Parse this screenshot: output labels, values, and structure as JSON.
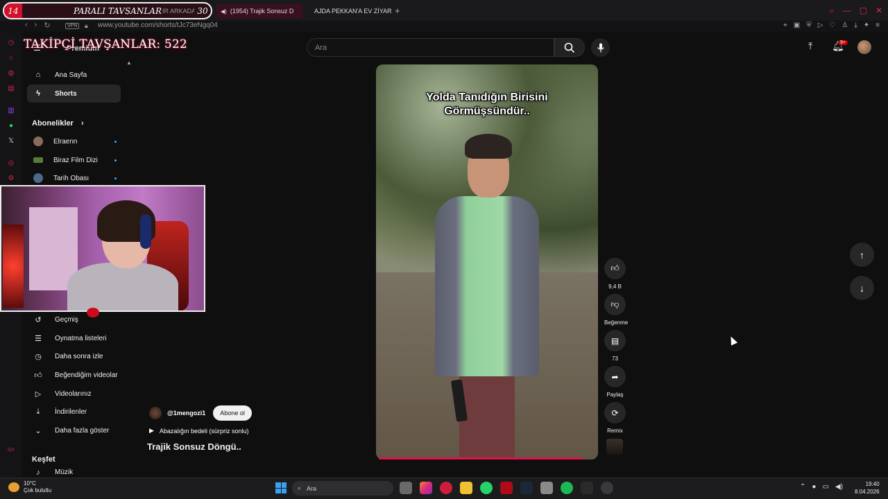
{
  "stream": {
    "left_number": "14",
    "brand": "PARALI TAVŞANLAR",
    "ticker": "IR ARKADAŞ İÇİN; SA",
    "right_number": "30",
    "follow_counter": "TAKİPÇİ TAVŞANLAR: 522"
  },
  "browser": {
    "tabs": [
      {
        "label": "(1954) Trajik Sonsuz D",
        "active": true
      },
      {
        "label": "AJDA PEKKAN'A EV ZİYAR",
        "active": false
      }
    ],
    "url": "www.youtube.com/shorts/tJc73eNgq04",
    "vpn": "VPN"
  },
  "header": {
    "premium": "Premium",
    "search_placeholder": "Ara",
    "notification_count": "9+"
  },
  "sidebar": {
    "main": [
      {
        "label": "Ana Sayfa",
        "icon": "home-icon"
      },
      {
        "label": "Shorts",
        "icon": "shorts-icon"
      }
    ],
    "subscriptions_heading": "Abonelikler",
    "subscriptions": [
      {
        "label": "Elraenn"
      },
      {
        "label": "Biraz Film Dizi"
      },
      {
        "label": "Tarih Obası"
      }
    ],
    "you_items": [
      {
        "label": "Geçmiş",
        "icon": "history-icon"
      },
      {
        "label": "Oynatma listeleri",
        "icon": "playlist-icon"
      },
      {
        "label": "Daha sonra izle",
        "icon": "clock-icon"
      },
      {
        "label": "Beğendiğim videolar",
        "icon": "thumbs-up-icon"
      },
      {
        "label": "Videolarınız",
        "icon": "video-icon"
      },
      {
        "label": "İndirilenler",
        "icon": "download-icon"
      },
      {
        "label": "Daha fazla göster",
        "icon": "chevron-down-icon"
      }
    ],
    "explore_heading": "Keşfet",
    "explore_first": "Müzik"
  },
  "short": {
    "caption_line1": "Yolda Tanıdığın Birisini",
    "caption_line2": "Görmüşsündür..",
    "channel": "@1mengozi1",
    "subscribe": "Abone ol",
    "linked_video": "Abazalığın bedeli (sürpriz sonlu)",
    "title": "Trajik Sonsuz Döngü..",
    "likes": "9,4 B",
    "dislike_label": "Beğenme",
    "comments": "73",
    "share_label": "Paylaş",
    "remix_label": "Remix"
  },
  "taskbar": {
    "temperature": "10°C",
    "weather": "Çok bulutlu",
    "search": "Ara",
    "time": "19:40",
    "date": "8.04.2026"
  }
}
